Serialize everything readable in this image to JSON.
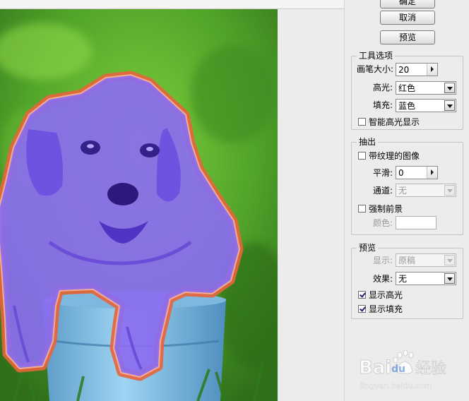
{
  "buttons": {
    "ok": "确定",
    "cancel": "取消",
    "preview": "预览"
  },
  "tool_options": {
    "title": "工具选项",
    "brush_size_label": "画笔大小:",
    "brush_size_value": "20",
    "highlight_label": "高光:",
    "highlight_value": "红色",
    "fill_label": "填充:",
    "fill_value": "蓝色",
    "smart_highlight_label": "智能高光显示",
    "smart_highlight_checked": false
  },
  "extract": {
    "title": "抽出",
    "textured_image_label": "带纹理的图像",
    "textured_image_checked": false,
    "smooth_label": "平滑:",
    "smooth_value": "0",
    "channel_label": "通道:",
    "channel_value": "无",
    "force_foreground_label": "强制前景",
    "force_foreground_checked": false,
    "color_label": "颜色:"
  },
  "preview_group": {
    "title": "预览",
    "show_label": "显示:",
    "show_value": "原稿",
    "effect_label": "效果:",
    "effect_value": "无",
    "show_highlight_label": "显示高光",
    "show_highlight_checked": true,
    "show_fill_label": "显示填充",
    "show_fill_checked": true
  },
  "watermark": {
    "brand_text": "Bai",
    "brand_suffix": "经验",
    "url": "jingyan.baidu.com"
  },
  "colors": {
    "highlight": "#e8643c",
    "fill": "#8a6cf0",
    "panel_bg": "#ececec"
  }
}
